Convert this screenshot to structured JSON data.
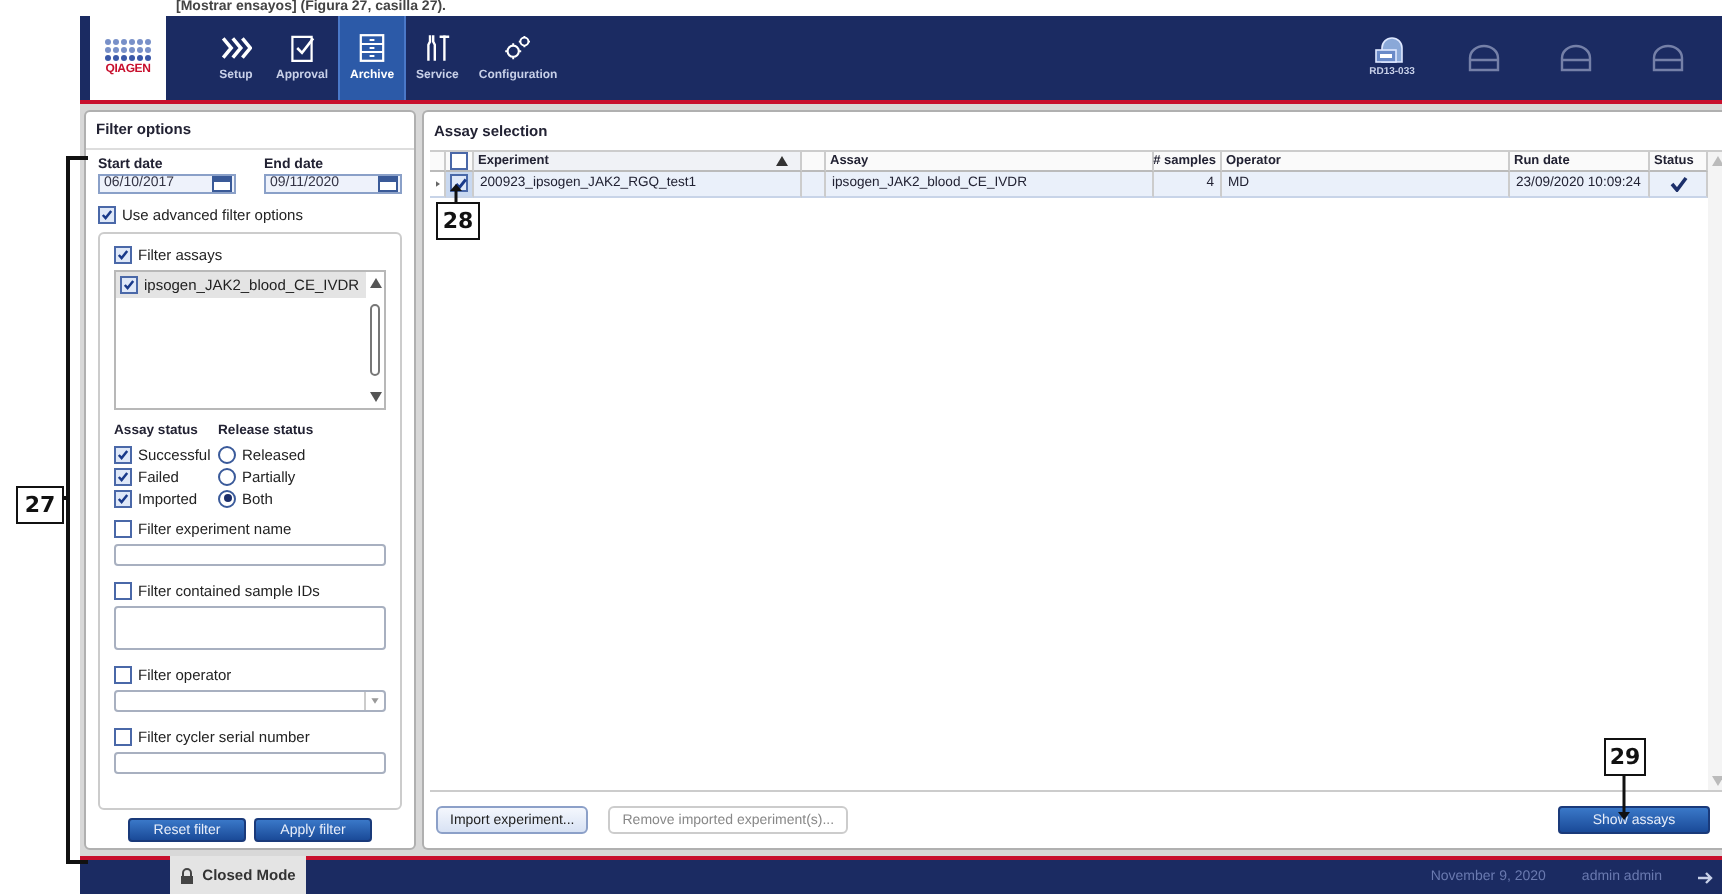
{
  "doc_caption": "[Mostrar ensayos] (Figura 27, casilla 27).",
  "toolbar": {
    "logo": "QIAGEN",
    "tabs": [
      {
        "label": "Setup",
        "selected": false
      },
      {
        "label": "Approval",
        "selected": false
      },
      {
        "label": "Archive",
        "selected": true
      },
      {
        "label": "Service",
        "selected": false
      },
      {
        "label": "Configuration",
        "selected": false
      }
    ],
    "instruments": [
      {
        "kind": "cycler",
        "label": "RD13-033"
      },
      {
        "kind": "empty"
      },
      {
        "kind": "empty"
      },
      {
        "kind": "empty"
      }
    ]
  },
  "filter_options": {
    "title": "Filter options",
    "start_date": {
      "label": "Start date",
      "value": "06/10/2017"
    },
    "end_date": {
      "label": "End date",
      "value": "09/11/2020"
    },
    "use_advanced": {
      "label": "Use advanced filter options",
      "checked": true
    },
    "filter_assays": {
      "label": "Filter assays",
      "checked": true,
      "items": [
        {
          "label": "ipsogen_JAK2_blood_CE_IVDR",
          "checked": true
        }
      ]
    },
    "assay_status": {
      "title": "Assay status",
      "options": [
        {
          "label": "Successful",
          "checked": true
        },
        {
          "label": "Failed",
          "checked": true
        },
        {
          "label": "Imported",
          "checked": true
        }
      ]
    },
    "release_status": {
      "title": "Release status",
      "options": [
        {
          "label": "Released",
          "selected": false
        },
        {
          "label": "Partially",
          "selected": false
        },
        {
          "label": "Both",
          "selected": true
        }
      ]
    },
    "filters": [
      {
        "kind": "text",
        "label": "Filter experiment name",
        "checked": false
      },
      {
        "kind": "textarea",
        "label": "Filter contained sample IDs",
        "checked": false
      },
      {
        "kind": "dropdown",
        "label": "Filter operator",
        "checked": false
      },
      {
        "kind": "text",
        "label": "Filter cycler serial number",
        "checked": false
      }
    ],
    "buttons": [
      "Reset filter",
      "Apply filter"
    ]
  },
  "assay_selection": {
    "title": "Assay selection",
    "select_all": {
      "checked": false
    },
    "columns": [
      {
        "label": "Experiment",
        "sorted": true
      },
      {
        "label": "Assay"
      },
      {
        "label": "# samples"
      },
      {
        "label": "Operator"
      },
      {
        "label": "Run date"
      },
      {
        "label": "Status"
      }
    ],
    "rows": [
      {
        "checked": true,
        "experiment": "200923_ipsogen_JAK2_RGQ_test1",
        "assay": "ipsogen_JAK2_blood_CE_IVDR",
        "samples": "4",
        "operator": "MD",
        "run_date": "23/09/2020 10:09:24",
        "succeeded": true
      }
    ],
    "buttons": [
      {
        "label": "Import experiment...",
        "disabled": false
      },
      {
        "label": "Remove imported experiment(s)...",
        "disabled": true
      }
    ],
    "primary_button": "Show assays"
  },
  "status_bar": {
    "mode": "Closed Mode",
    "date": "November 9, 2020",
    "user": "admin admin"
  },
  "callouts": [
    {
      "label": "27"
    },
    {
      "label": "28"
    },
    {
      "label": "29"
    }
  ]
}
